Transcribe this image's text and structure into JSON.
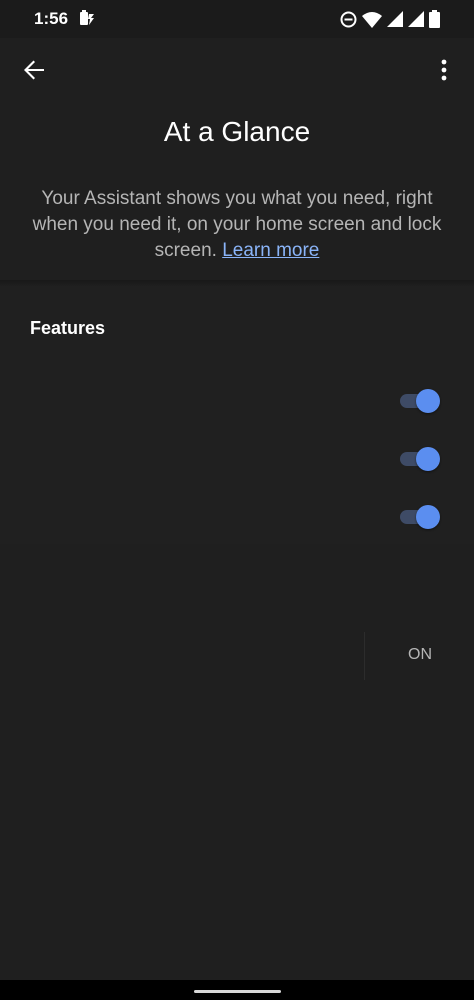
{
  "status_bar": {
    "time": "1:56",
    "icons": [
      "battery-saver-icon",
      "dnd-icon",
      "wifi-icon",
      "signal-icon",
      "signal-icon",
      "battery-icon"
    ]
  },
  "app_bar": {
    "back_icon": "arrow-back-icon",
    "more_icon": "more-vert-icon"
  },
  "header": {
    "title": "At a Glance",
    "description": "Your Assistant shows you what you need, right when you need it, on your home screen and lock screen.",
    "learn_more": "Learn more"
  },
  "features": {
    "heading": "Features",
    "toggles": [
      {
        "state": "on"
      },
      {
        "state": "on"
      },
      {
        "state": "on"
      }
    ]
  },
  "lower": {
    "on_label": "ON"
  },
  "colors": {
    "background": "#1f1f1f",
    "accent": "#5b8ef0",
    "track": "#3e4b66",
    "link": "#8ab4f8",
    "secondary_text": "#b5b5b5"
  }
}
